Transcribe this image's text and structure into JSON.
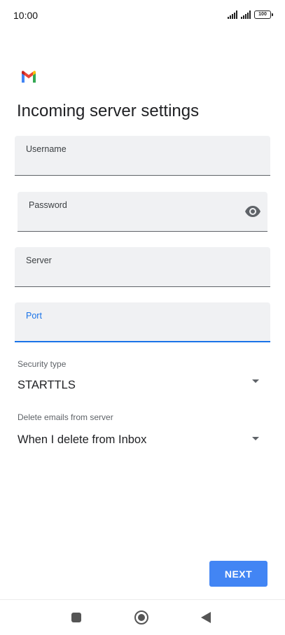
{
  "status_bar": {
    "time": "10:00",
    "battery": "100"
  },
  "header": {
    "title": "Incoming server settings"
  },
  "form": {
    "username": {
      "label": "Username",
      "value": ""
    },
    "password": {
      "label": "Password",
      "value": ""
    },
    "server": {
      "label": "Server",
      "value": ""
    },
    "port": {
      "label": "Port",
      "value": ""
    }
  },
  "security_type": {
    "caption": "Security type",
    "value": "STARTTLS"
  },
  "delete_emails": {
    "caption": "Delete emails from server",
    "value": "When I delete from Inbox"
  },
  "actions": {
    "next_label": "NEXT"
  },
  "colors": {
    "accent": "#1a73e8",
    "button": "#4285f4",
    "field_bg": "#f0f1f3"
  }
}
